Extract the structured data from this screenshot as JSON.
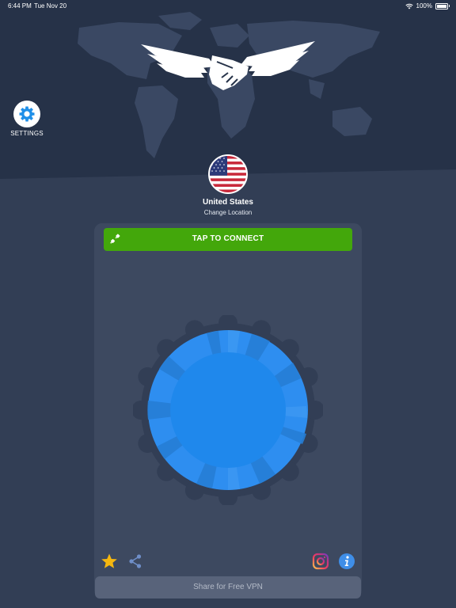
{
  "status_bar": {
    "time": "6:44 PM",
    "date": "Tue Nov 20",
    "battery": "100%"
  },
  "settings": {
    "label": "SETTINGS"
  },
  "location": {
    "country": "United States",
    "change_label": "Change Location"
  },
  "connect": {
    "label": "TAP TO CONNECT"
  },
  "share_free": {
    "label": "Share for Free VPN"
  },
  "icons": {
    "settings": "gear-icon",
    "flag": "us-flag-icon",
    "connect": "plug-icon",
    "favorite": "star-icon",
    "share": "share-icon",
    "instagram": "instagram-icon",
    "info": "info-icon",
    "logo": "handshake-wings-logo"
  },
  "colors": {
    "background": "#323e55",
    "hero": "#263248",
    "panel": "#3d4960",
    "connect_green": "#43a70b",
    "knob_blue": "#2e8ef0",
    "star": "#f5b70f",
    "info_blue": "#3f8ee8"
  }
}
